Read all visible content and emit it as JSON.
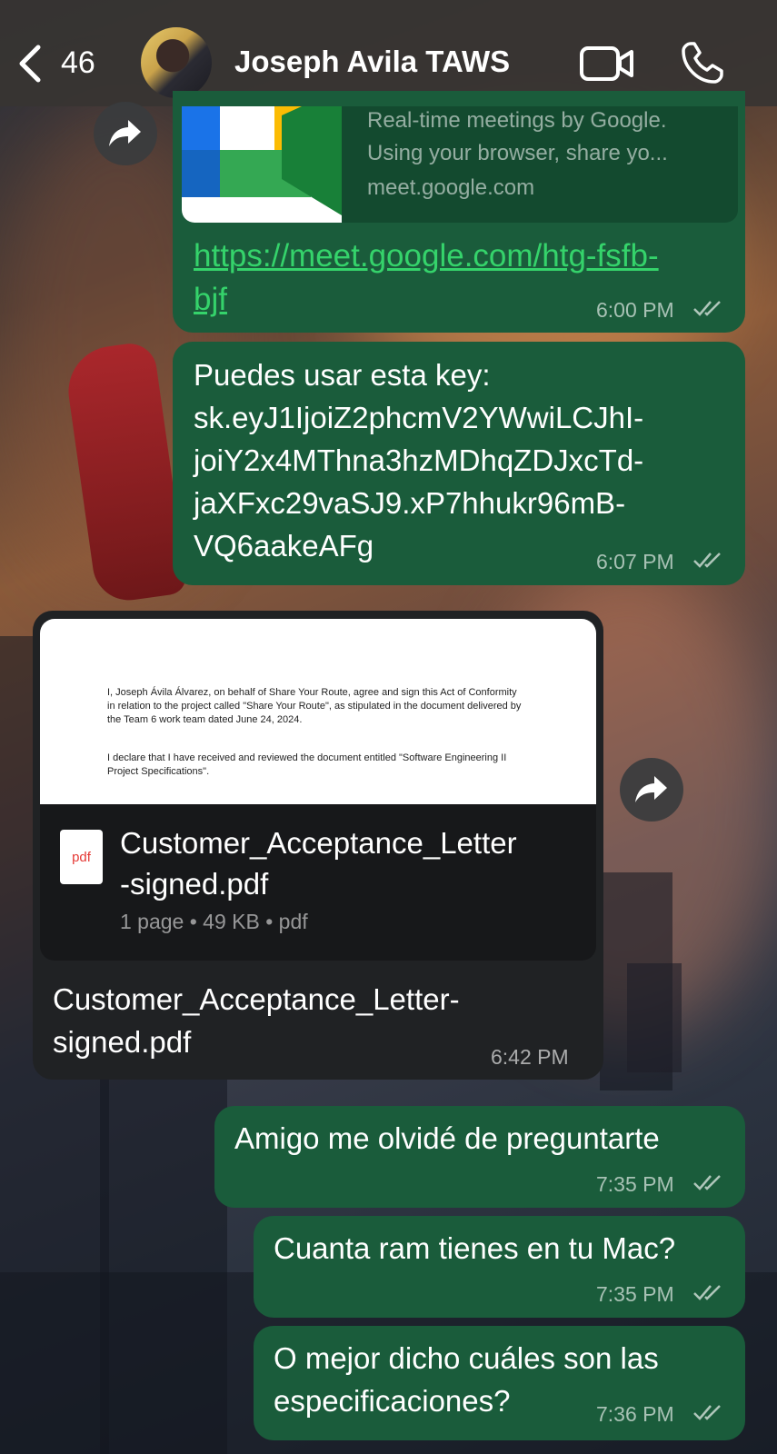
{
  "header": {
    "back_count": "46",
    "contact_name": "Joseph Avila TAWS"
  },
  "messages": {
    "link_msg": {
      "preview_desc_1": "Real-time meetings by Google.",
      "preview_desc_2": "Using your browser, share yo...",
      "preview_domain": "meet.google.com",
      "url_line_1": "https://meet.google.com/htg-fsfb-",
      "url_line_2": "bjf",
      "time": "6:00 PM"
    },
    "key_msg": {
      "lines": [
        "Puedes usar esta key:",
        "sk.eyJ1IjoiZ2phcmV2YWwiLCJhI-",
        "joiY2x4MThna3hzMDhqZDJxcTd-",
        "jaXFxc29vaSJ9.xP7hhukr96mB-",
        "VQ6aakeAFg"
      ],
      "time": "6:07 PM"
    },
    "doc_msg": {
      "doc_text_1": "I, Joseph Ávila Álvarez, on behalf of Share Your Route, agree and sign this Act of Conformity in relation to the project called \"Share Your Route\", as stipulated in the document delivered by the Team 6 work team dated June 24, 2024.",
      "doc_text_2": "I declare that I have received and reviewed the document entitled \"Software Engineering II Project Specifications\".",
      "file_icon_label": "pdf",
      "file_name_1": "Customer_Acceptance_Letter",
      "file_name_2": "-signed.pdf",
      "file_meta": "1 page • 49 KB • pdf",
      "caption_1": "Customer_Acceptance_Letter-",
      "caption_2": "signed.pdf",
      "time": "6:42 PM"
    },
    "msg_4": {
      "text": "Amigo me olvidé de preguntarte",
      "time": "7:35 PM"
    },
    "msg_5": {
      "text": "Cuanta ram tienes en tu Mac?",
      "time": "7:35 PM"
    },
    "msg_6": {
      "line_1": "O mejor dicho cuáles son las",
      "line_2": "especificaciones?",
      "time": "7:36 PM"
    }
  },
  "colors": {
    "outgoing_bubble": "#1a5c3b",
    "incoming_bubble": "#202224",
    "link": "#35d36b"
  }
}
